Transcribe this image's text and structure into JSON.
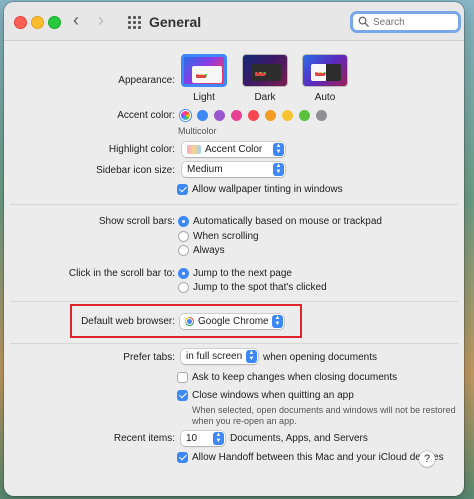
{
  "window": {
    "title": "General"
  },
  "search": {
    "placeholder": "Search"
  },
  "appearance": {
    "label": "Appearance:",
    "options": [
      "Light",
      "Dark",
      "Auto"
    ],
    "selected": "Light"
  },
  "accent_color": {
    "label": "Accent color:",
    "selected_name": "Multicolor",
    "swatches": [
      "#3d88f6",
      "#9b59d0",
      "#e84393",
      "#f5474f",
      "#f39c26",
      "#f7c531",
      "#5ac13f",
      "#8e8e93"
    ]
  },
  "highlight_color": {
    "label": "Highlight color:",
    "value": "Accent Color"
  },
  "sidebar_icon_size": {
    "label": "Sidebar icon size:",
    "value": "Medium"
  },
  "wallpaper_tinting": {
    "label": "Allow wallpaper tinting in windows",
    "checked": true
  },
  "scroll_bars": {
    "label": "Show scroll bars:",
    "options": [
      "Automatically based on mouse or trackpad",
      "When scrolling",
      "Always"
    ],
    "selected": 0
  },
  "scroll_click": {
    "label": "Click in the scroll bar to:",
    "options": [
      "Jump to the next page",
      "Jump to the spot that's clicked"
    ],
    "selected": 0
  },
  "default_browser": {
    "label": "Default web browser:",
    "value": "Google Chrome"
  },
  "prefer_tabs": {
    "label": "Prefer tabs:",
    "value": "in full screen",
    "suffix": "when opening documents"
  },
  "ask_keep_changes": {
    "label": "Ask to keep changes when closing documents",
    "checked": false
  },
  "close_windows": {
    "label": "Close windows when quitting an app",
    "checked": true,
    "note_line1": "When selected, open documents and windows will not be restored",
    "note_line2": "when you re-open an app."
  },
  "recent_items": {
    "label": "Recent items:",
    "value": "10",
    "suffix": "Documents, Apps, and Servers"
  },
  "handoff": {
    "label": "Allow Handoff between this Mac and your iCloud devices",
    "checked": true
  },
  "help": {
    "symbol": "?"
  },
  "colors": {
    "accent": "#3d88f6",
    "highlight_box": "#e0242e"
  }
}
